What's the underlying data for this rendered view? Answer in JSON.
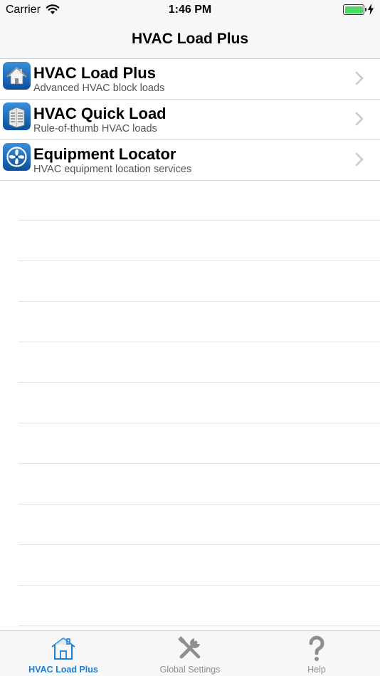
{
  "status_bar": {
    "carrier": "Carrier",
    "time": "1:46 PM",
    "battery_level": 1.0
  },
  "nav": {
    "title": "HVAC Load Plus"
  },
  "list": {
    "items": [
      {
        "title": "HVAC Load Plus",
        "subtitle": "Advanced HVAC block loads",
        "icon": "house-icon"
      },
      {
        "title": "HVAC Quick Load",
        "subtitle": "Rule-of-thumb HVAC loads",
        "icon": "building-icon"
      },
      {
        "title": "Equipment Locator",
        "subtitle": "HVAC equipment location services",
        "icon": "fan-icon"
      }
    ]
  },
  "tab_bar": {
    "tabs": [
      {
        "label": "HVAC Load Plus",
        "icon": "house-outline-icon",
        "active": true
      },
      {
        "label": "Global Settings",
        "icon": "tools-icon",
        "active": false
      },
      {
        "label": "Help",
        "icon": "question-mark-icon",
        "active": false
      }
    ]
  },
  "colors": {
    "accent": "#1a7fd6",
    "battery": "#4cd964",
    "inactive": "#8e8e93"
  }
}
